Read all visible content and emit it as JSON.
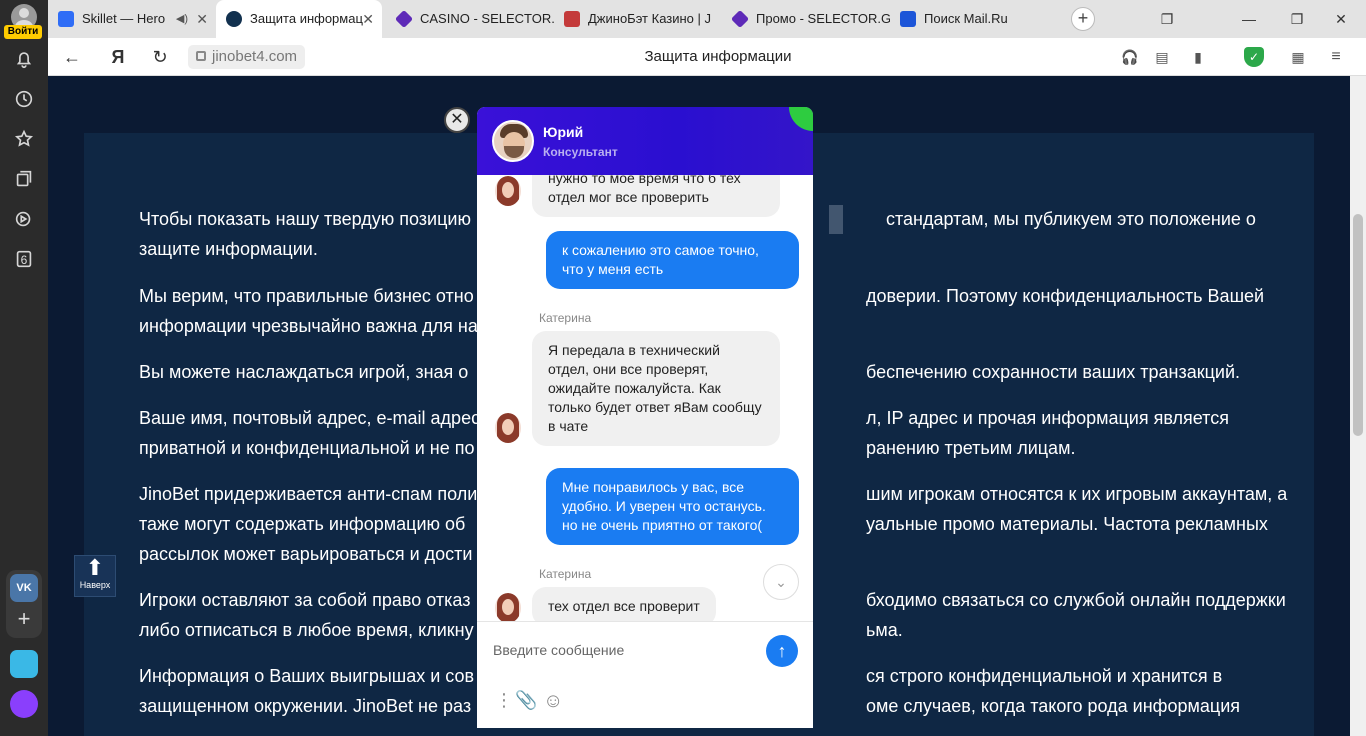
{
  "browser": {
    "login_label": "Войти",
    "sidebar_badge": "6",
    "vk_label": "VK",
    "tabs": [
      {
        "title": "Skillet — Hero",
        "color": "#2f6df6"
      },
      {
        "title": "Защита информац",
        "color": "#12314f"
      },
      {
        "title": "CASINO - SELECTOR.G",
        "color": "#5e2ab8"
      },
      {
        "title": "ДжиноБэт Казино | J",
        "color": "#c43a3a"
      },
      {
        "title": "Промо - SELECTOR.G",
        "color": "#5e2ab8"
      },
      {
        "title": "Поиск Mail.Ru",
        "color": "#1c55d8"
      }
    ],
    "url": "jinobet4.com",
    "page_title": "Защита информации"
  },
  "page": {
    "paragraphs": [
      {
        "line1": "Чтобы показать нашу твердую позицию",
        "line1b": "стандартам, мы публикуем это положение о",
        "line2": "защите информации."
      },
      {
        "line1": "Мы верим, что правильные бизнес отно",
        "line1b": "доверии. Поэтому конфиденциальность Вашей",
        "line2": "информации чрезвычайно важна для на"
      },
      {
        "line1": "Вы можете наслаждаться игрой, зная о",
        "line1b": "беспечению сохранности ваших транзакций."
      },
      {
        "line1": "Ваше имя, почтовый адрес, e-mail адрес",
        "line1b": "л, IP адрес и прочая информация является",
        "line2": "приватной и конфиденциальной и не по",
        "line2b": "ранению третьим лицам."
      },
      {
        "line1": "JinoBet придерживается анти-спам поли",
        "line1b": "шим игрокам относятся к их игровым аккаунтам, а",
        "line2": "таже могут содержать информацию об",
        "line2b": "уальные промо материалы. Частота рекламных",
        "line3": "рассылок может варьироваться и дости"
      },
      {
        "line1": "Игроки оставляют за собой право отказ",
        "line1b": "бходимо связаться со службой онлайн поддержки",
        "line2": "либо отписаться в любое время, кликну",
        "line2b": "ьма."
      },
      {
        "line1": "Информация о Ваших выигрышах и сов",
        "line1b": "ся строго конфиденциальной и хранится в",
        "line2": "защищенном окружении. JinoBet не раз",
        "line2b": "оме случаев, когда такого рода информация"
      }
    ],
    "up_button_label": "Наверх"
  },
  "chat": {
    "operator_name": "Юрий",
    "operator_role": "Консультант",
    "messages": {
      "m1_line1": "нужно то мое время  что б тех",
      "m1_line2": "отдел мог все проверить",
      "m2": "к сожалению это самое точно, что у меня есть",
      "sender": "Катерина",
      "m3": "Я передала в технический отдел, они все проверят, ожидайте пожалуйста. Как только будет ответ яВам сообщу в чате",
      "m4": "Мне понравилось у вас, все удобно. И уверен что останусь. но не очень приятно от такого(",
      "sender2": "Катерина",
      "m5": "тех отдел все проверит"
    },
    "input_placeholder": "Введите сообщение",
    "colors": {
      "header": "#2a0fd0",
      "outgoing": "#1a7cf2",
      "online": "#2ecc40"
    }
  }
}
